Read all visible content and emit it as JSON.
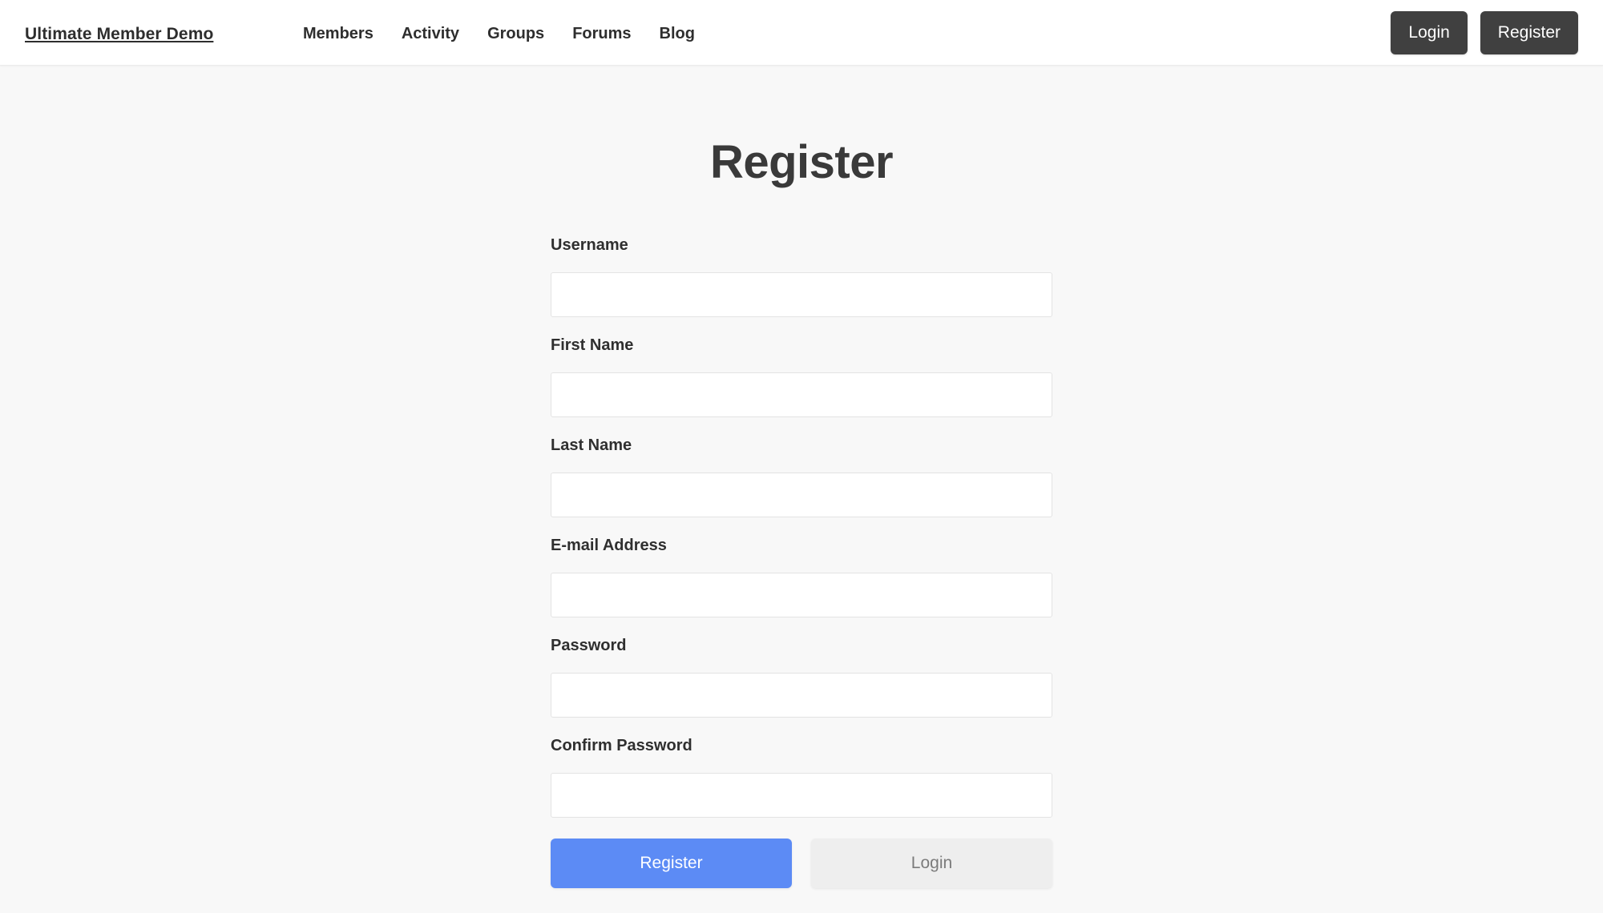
{
  "header": {
    "site_title": "Ultimate Member Demo",
    "nav": [
      {
        "label": "Members"
      },
      {
        "label": "Activity"
      },
      {
        "label": "Groups"
      },
      {
        "label": "Forums"
      },
      {
        "label": "Blog"
      }
    ],
    "login_label": "Login",
    "register_label": "Register",
    "button_color": "#404040"
  },
  "main": {
    "page_title": "Register",
    "fields": [
      {
        "label": "Username",
        "value": "",
        "placeholder": ""
      },
      {
        "label": "First Name",
        "value": "",
        "placeholder": ""
      },
      {
        "label": "Last Name",
        "value": "",
        "placeholder": ""
      },
      {
        "label": "E-mail Address",
        "value": "",
        "placeholder": ""
      },
      {
        "label": "Password",
        "value": "",
        "placeholder": ""
      },
      {
        "label": "Confirm Password",
        "value": "",
        "placeholder": ""
      }
    ],
    "submit_label": "Register",
    "login_label": "Login",
    "submit_color": "#5c8bf5",
    "login_color": "#eeeeee"
  }
}
